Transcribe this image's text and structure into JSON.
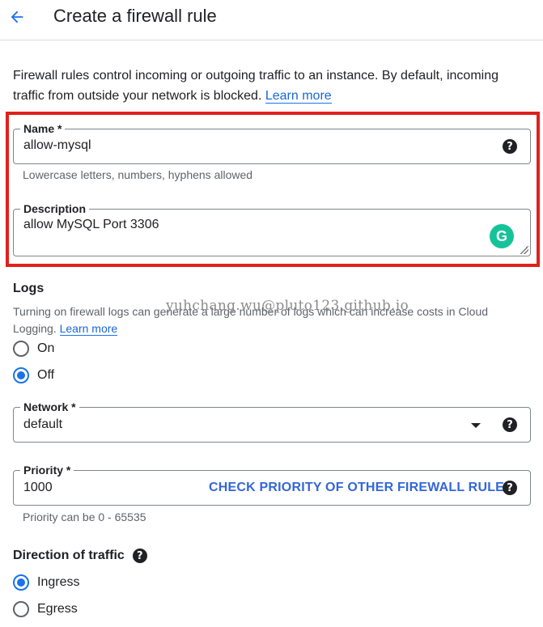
{
  "header": {
    "title": "Create a firewall rule",
    "back_icon": "arrow-left-icon"
  },
  "intro": {
    "text": "Firewall rules control incoming or outgoing traffic to an instance. By default, incoming traffic from outside your network is blocked.",
    "link": "Learn more"
  },
  "name_field": {
    "label": "Name *",
    "value": "allow-mysql",
    "hint": "Lowercase letters, numbers, hyphens allowed"
  },
  "description_field": {
    "label": "Description",
    "value": "allow MySQL Port 3306"
  },
  "logs": {
    "title": "Logs",
    "text": "Turning on firewall logs can generate a large number of logs which can increase costs in Cloud Logging.",
    "link": "Learn more",
    "options": [
      {
        "label": "On",
        "selected": false
      },
      {
        "label": "Off",
        "selected": true
      }
    ]
  },
  "watermark": "yuhchang.wu@pluto123.github.io",
  "network_field": {
    "label": "Network *",
    "value": "default"
  },
  "priority_field": {
    "label": "Priority *",
    "value": "1000",
    "link": "CHECK PRIORITY OF OTHER FIREWALL RULES",
    "hint": "Priority can be 0 - 65535"
  },
  "direction": {
    "title": "Direction of traffic",
    "options": [
      {
        "label": "Ingress",
        "selected": true
      },
      {
        "label": "Egress",
        "selected": false
      }
    ]
  },
  "colors": {
    "accent": "#1a73e8",
    "highlight": "#e0201b",
    "grammarly": "#15c39a"
  }
}
